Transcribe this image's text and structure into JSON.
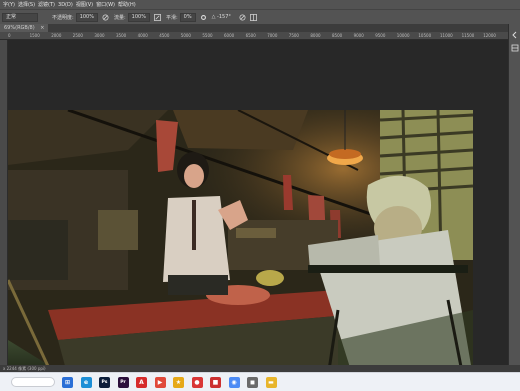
{
  "menubar": {
    "items": [
      "字(Y)",
      "选择(S)",
      "滤镜(T)",
      "3D(D)",
      "视图(V)",
      "窗口(W)",
      "帮助(H)"
    ]
  },
  "options": {
    "mode_value": "正常",
    "opacity_label": "不透明度:",
    "opacity_value": "100%",
    "flow_label": "流量:",
    "flow_value": "100%",
    "smooth_label": "平滑:",
    "smooth_value": "0%",
    "angle_value": "△ -157°"
  },
  "tab": {
    "title": "69%(RGB/8)",
    "close": "×"
  },
  "ruler": {
    "ticks": [
      "0",
      "1500",
      "2000",
      "2500",
      "3000",
      "3500",
      "4000",
      "4500",
      "5000",
      "5500",
      "6000",
      "6500",
      "7000",
      "7500",
      "8000",
      "8500",
      "9000",
      "9500",
      "10000",
      "10500",
      "11000",
      "11500",
      "12000"
    ]
  },
  "status": {
    "text": "x 2244 像素 (300 ppi)"
  },
  "taskbar": {
    "search_placeholder": "",
    "apps": [
      {
        "name": "windows-start-icon",
        "glyph": "⊞",
        "color": "#2b6fd6"
      },
      {
        "name": "edge-icon",
        "glyph": "e",
        "color": "#1d8fd6"
      },
      {
        "name": "photoshop-icon",
        "glyph": "Ps",
        "color": "#0c1d3a"
      },
      {
        "name": "premiere-icon",
        "glyph": "Pr",
        "color": "#2b0f3b"
      },
      {
        "name": "acrobat-icon",
        "glyph": "A",
        "color": "#d62b2b"
      },
      {
        "name": "red-app-icon",
        "glyph": "▶",
        "color": "#e0493a"
      },
      {
        "name": "yellow-app-icon",
        "glyph": "★",
        "color": "#e6a817"
      },
      {
        "name": "red-circle-app-icon",
        "glyph": "●",
        "color": "#d93636"
      },
      {
        "name": "red-app-2-icon",
        "glyph": "■",
        "color": "#cc3030"
      },
      {
        "name": "chrome-icon",
        "glyph": "◉",
        "color": "#4c8bf5"
      },
      {
        "name": "wechat-icon",
        "glyph": "◼",
        "color": "#6a6a6a"
      },
      {
        "name": "file-explorer-icon",
        "glyph": "▬",
        "color": "#e8b52b"
      }
    ]
  },
  "colors": {
    "app_bg": "#535353",
    "workspace": "#282828",
    "accent": "#2b6fd6"
  }
}
